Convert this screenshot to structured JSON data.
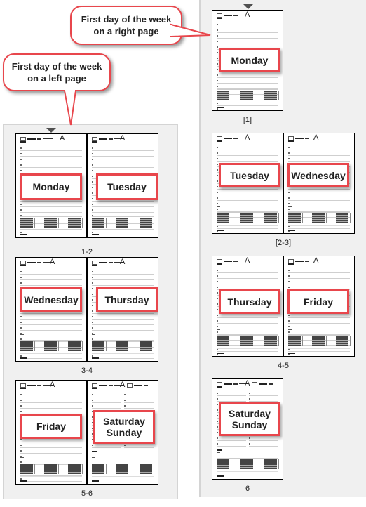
{
  "callouts": {
    "right_page": {
      "line1": "First day of the week",
      "line2": "on a right page"
    },
    "left_page": {
      "line1": "First day of the week",
      "line2": "on a left page"
    }
  },
  "colors": {
    "accent": "#e8464c",
    "panel_bg": "#f0f0f0",
    "marker": "#505050"
  },
  "left_panel": {
    "spreads": [
      {
        "label": "1-2",
        "pages": [
          {
            "day": "Monday"
          },
          {
            "day": "Tuesday"
          }
        ]
      },
      {
        "label": "3-4",
        "pages": [
          {
            "day": "Wednesday"
          },
          {
            "day": "Thursday"
          }
        ]
      },
      {
        "label": "5-6",
        "pages": [
          {
            "day": "Friday"
          },
          {
            "day_line1": "Saturday",
            "day_line2": "Sunday"
          }
        ]
      }
    ]
  },
  "right_panel": {
    "spreads": [
      {
        "label": "[1]",
        "pages": [
          {
            "day": "Monday"
          }
        ]
      },
      {
        "label": "[2-3]",
        "pages": [
          {
            "day": "Tuesday"
          },
          {
            "day": "Wednesday"
          }
        ]
      },
      {
        "label": "4-5",
        "pages": [
          {
            "day": "Thursday"
          },
          {
            "day": "Friday"
          }
        ]
      },
      {
        "label": "6",
        "pages": [
          {
            "day_line1": "Saturday",
            "day_line2": "Sunday"
          }
        ]
      }
    ]
  },
  "page_header_letter": "A"
}
